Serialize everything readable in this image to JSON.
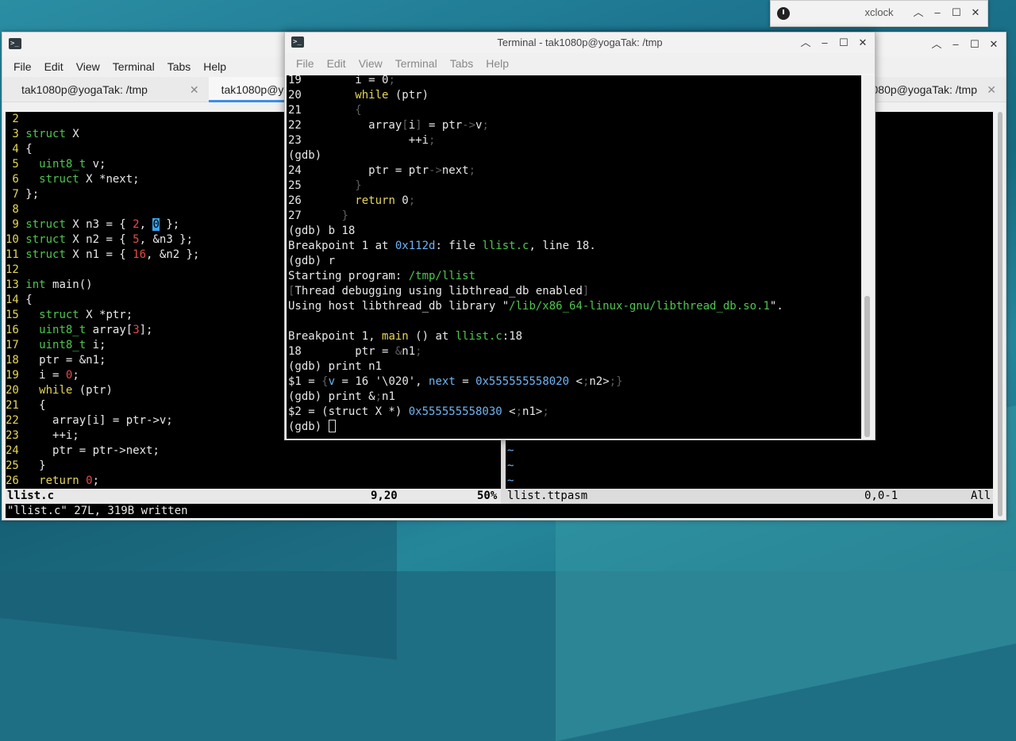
{
  "xclock": {
    "title": "xclock"
  },
  "main_window": {
    "menu": [
      "File",
      "Edit",
      "View",
      "Terminal",
      "Tabs",
      "Help"
    ],
    "tabs": [
      {
        "label": "tak1080p@yogaTak: /tmp",
        "close": "✕"
      },
      {
        "label": "tak1080p@yogaTak: /tmp",
        "close": "✕"
      },
      {
        "label": "tak1080p@yogaTak: /tmp",
        "close": "✕"
      }
    ]
  },
  "editor": {
    "lines": [
      {
        "n": " 2",
        "t": ""
      },
      {
        "n": " 3",
        "t": "struct X"
      },
      {
        "n": " 4",
        "t": "{"
      },
      {
        "n": " 5",
        "t": "  uint8_t v;"
      },
      {
        "n": " 6",
        "t": "  struct X *next;"
      },
      {
        "n": " 7",
        "t": "};"
      },
      {
        "n": " 8",
        "t": ""
      },
      {
        "n": " 9",
        "t": "struct X n3 = { 2, 0 };"
      },
      {
        "n": "10",
        "t": "struct X n2 = { 5, &n3 };"
      },
      {
        "n": "11",
        "t": "struct X n1 = { 16, &n2 };"
      },
      {
        "n": "12",
        "t": ""
      },
      {
        "n": "13",
        "t": "int main()"
      },
      {
        "n": "14",
        "t": "{"
      },
      {
        "n": "15",
        "t": "  struct X *ptr;"
      },
      {
        "n": "16",
        "t": "  uint8_t array[3];"
      },
      {
        "n": "17",
        "t": "  uint8_t i;"
      },
      {
        "n": "18",
        "t": "  ptr = &n1;"
      },
      {
        "n": "19",
        "t": "  i = 0;"
      },
      {
        "n": "20",
        "t": "  while (ptr)"
      },
      {
        "n": "21",
        "t": "  {"
      },
      {
        "n": "22",
        "t": "    array[i] = ptr->v;"
      },
      {
        "n": "23",
        "t": "    ++i;"
      },
      {
        "n": "24",
        "t": "    ptr = ptr->next;"
      },
      {
        "n": "25",
        "t": "  }"
      },
      {
        "n": "26",
        "t": "  return 0;"
      }
    ],
    "status_left": "llist.c",
    "status_pos": "9,20",
    "status_pct": "50%",
    "status_right_file": "llist.ttpasm",
    "status_right_pos": "0,0-1",
    "status_right_all": "All",
    "tildes": [
      "~",
      "~",
      "~"
    ],
    "message": "\"llist.c\" 27L, 319B written"
  },
  "gdb": {
    "title": "Terminal - tak1080p@yogaTak: /tmp",
    "menu": [
      "File",
      "Edit",
      "View",
      "Terminal",
      "Tabs",
      "Help"
    ],
    "lines": [
      "19        i = 0;",
      "20        while (ptr)",
      "21        {",
      "22          array[i] = ptr->v;",
      "23                ++i;",
      "(gdb)",
      "24          ptr = ptr->next;",
      "25        }",
      "26        return 0;",
      "27      }",
      "(gdb) b 18",
      "Breakpoint 1 at 0x112d: file llist.c, line 18.",
      "(gdb) r",
      "Starting program: /tmp/llist",
      "[Thread debugging using libthread_db enabled]",
      "Using host libthread_db library \"/lib/x86_64-linux-gnu/libthread_db.so.1\".",
      "",
      "Breakpoint 1, main () at llist.c:18",
      "18        ptr = &n1;",
      "(gdb) print n1",
      "$1 = {v = 16 '\\020', next = 0x555555558020 <n2>}",
      "(gdb) print &n1",
      "$2 = (struct X *) 0x555555558030 <n1>",
      "(gdb) "
    ]
  }
}
